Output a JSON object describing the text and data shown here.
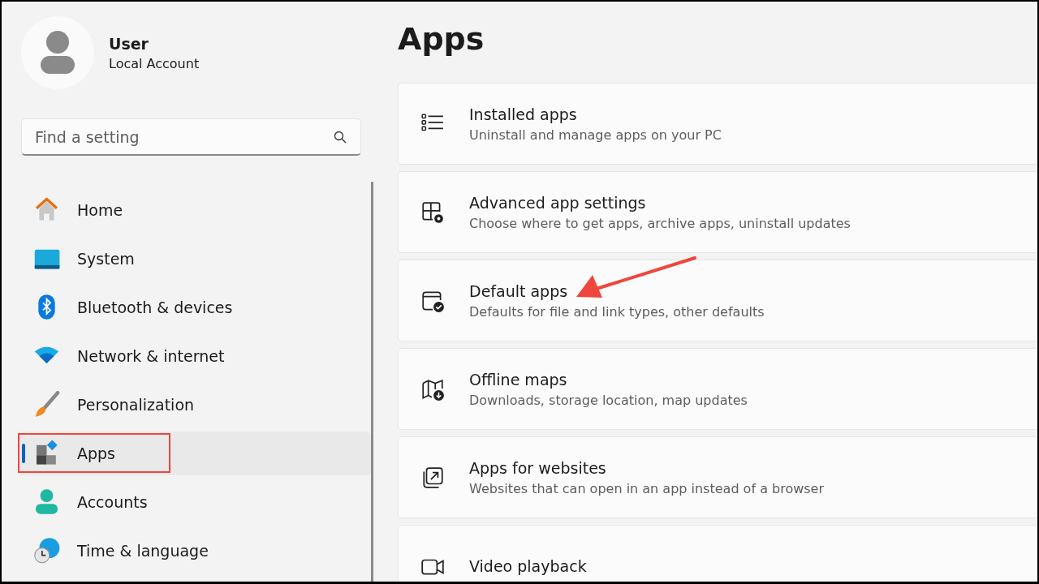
{
  "account": {
    "name": "User",
    "type": "Local Account"
  },
  "search": {
    "placeholder": "Find a setting"
  },
  "nav": [
    {
      "label": "Home",
      "selected": false,
      "annotated": false
    },
    {
      "label": "System",
      "selected": false,
      "annotated": false
    },
    {
      "label": "Bluetooth & devices",
      "selected": false,
      "annotated": false
    },
    {
      "label": "Network & internet",
      "selected": false,
      "annotated": false
    },
    {
      "label": "Personalization",
      "selected": false,
      "annotated": false
    },
    {
      "label": "Apps",
      "selected": true,
      "annotated": true
    },
    {
      "label": "Accounts",
      "selected": false,
      "annotated": false
    },
    {
      "label": "Time & language",
      "selected": false,
      "annotated": false
    }
  ],
  "page_title": "Apps",
  "cards": [
    {
      "title": "Installed apps",
      "description": "Uninstall and manage apps on your PC",
      "pointed": false
    },
    {
      "title": "Advanced app settings",
      "description": "Choose where to get apps, archive apps, uninstall updates",
      "pointed": false
    },
    {
      "title": "Default apps",
      "description": "Defaults for file and link types, other defaults",
      "pointed": true
    },
    {
      "title": "Offline maps",
      "description": "Downloads, storage location, map updates",
      "pointed": false
    },
    {
      "title": "Apps for websites",
      "description": "Websites that can open in an app instead of a browser",
      "pointed": false
    },
    {
      "title": "Video playback",
      "pointed": false
    }
  ]
}
